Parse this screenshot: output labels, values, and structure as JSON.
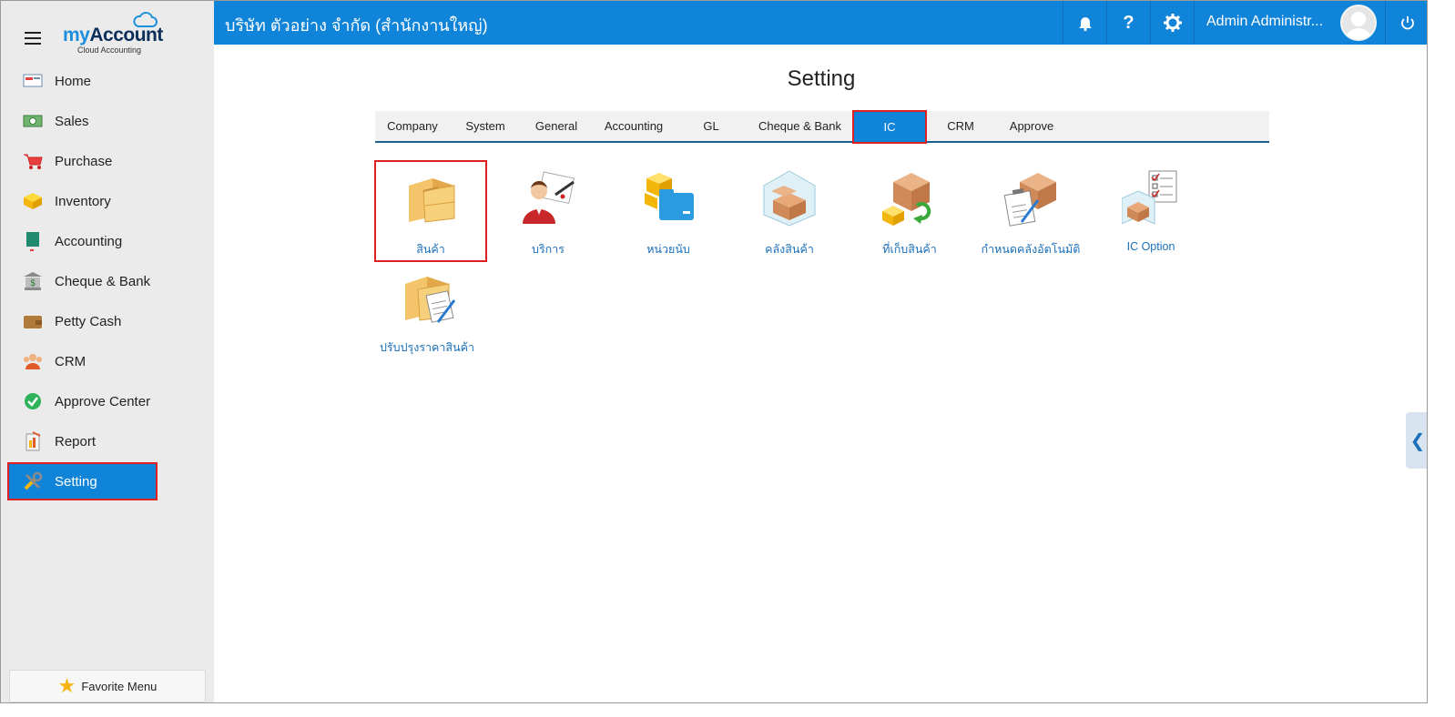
{
  "app": {
    "logo_my": "my",
    "logo_account": "Account",
    "logo_sub": "Cloud Accounting",
    "company": "บริษัท ตัวอย่าง จำกัด (สำนักงานใหญ่)",
    "user": "Admin Administr...",
    "accent": "#1084d8"
  },
  "sidebar": {
    "items": [
      {
        "label": "Home",
        "icon": "home-icon"
      },
      {
        "label": "Sales",
        "icon": "money-icon"
      },
      {
        "label": "Purchase",
        "icon": "cart-icon"
      },
      {
        "label": "Inventory",
        "icon": "box-icon"
      },
      {
        "label": "Accounting",
        "icon": "book-icon"
      },
      {
        "label": "Cheque & Bank",
        "icon": "bank-icon"
      },
      {
        "label": "Petty Cash",
        "icon": "wallet-icon"
      },
      {
        "label": "CRM",
        "icon": "people-icon"
      },
      {
        "label": "Approve Center",
        "icon": "check-icon"
      },
      {
        "label": "Report",
        "icon": "report-icon"
      },
      {
        "label": "Setting",
        "icon": "tools-icon",
        "active": true
      }
    ],
    "favorite": "Favorite Menu"
  },
  "main": {
    "title": "Setting",
    "tabs": [
      "Company",
      "System",
      "General",
      "Accounting",
      "GL",
      "Cheque & Bank",
      "IC",
      "CRM",
      "Approve"
    ],
    "active_tab": "IC",
    "tiles": [
      {
        "label": "สินค้า",
        "icon": "boxes-icon"
      },
      {
        "label": "บริการ",
        "icon": "service-person-icon"
      },
      {
        "label": "หน่วยนับ",
        "icon": "unit-folder-icon"
      },
      {
        "label": "คลังสินค้า",
        "icon": "warehouse-icon"
      },
      {
        "label": "ที่เก็บสินค้า",
        "icon": "storage-location-icon"
      },
      {
        "label": "กำหนดคลังอัตโนมัติ",
        "icon": "auto-warehouse-icon"
      },
      {
        "label": "IC Option",
        "icon": "ic-option-icon"
      },
      {
        "label": "ปรับปรุงราคาสินค้า",
        "icon": "price-adjust-icon"
      }
    ]
  }
}
